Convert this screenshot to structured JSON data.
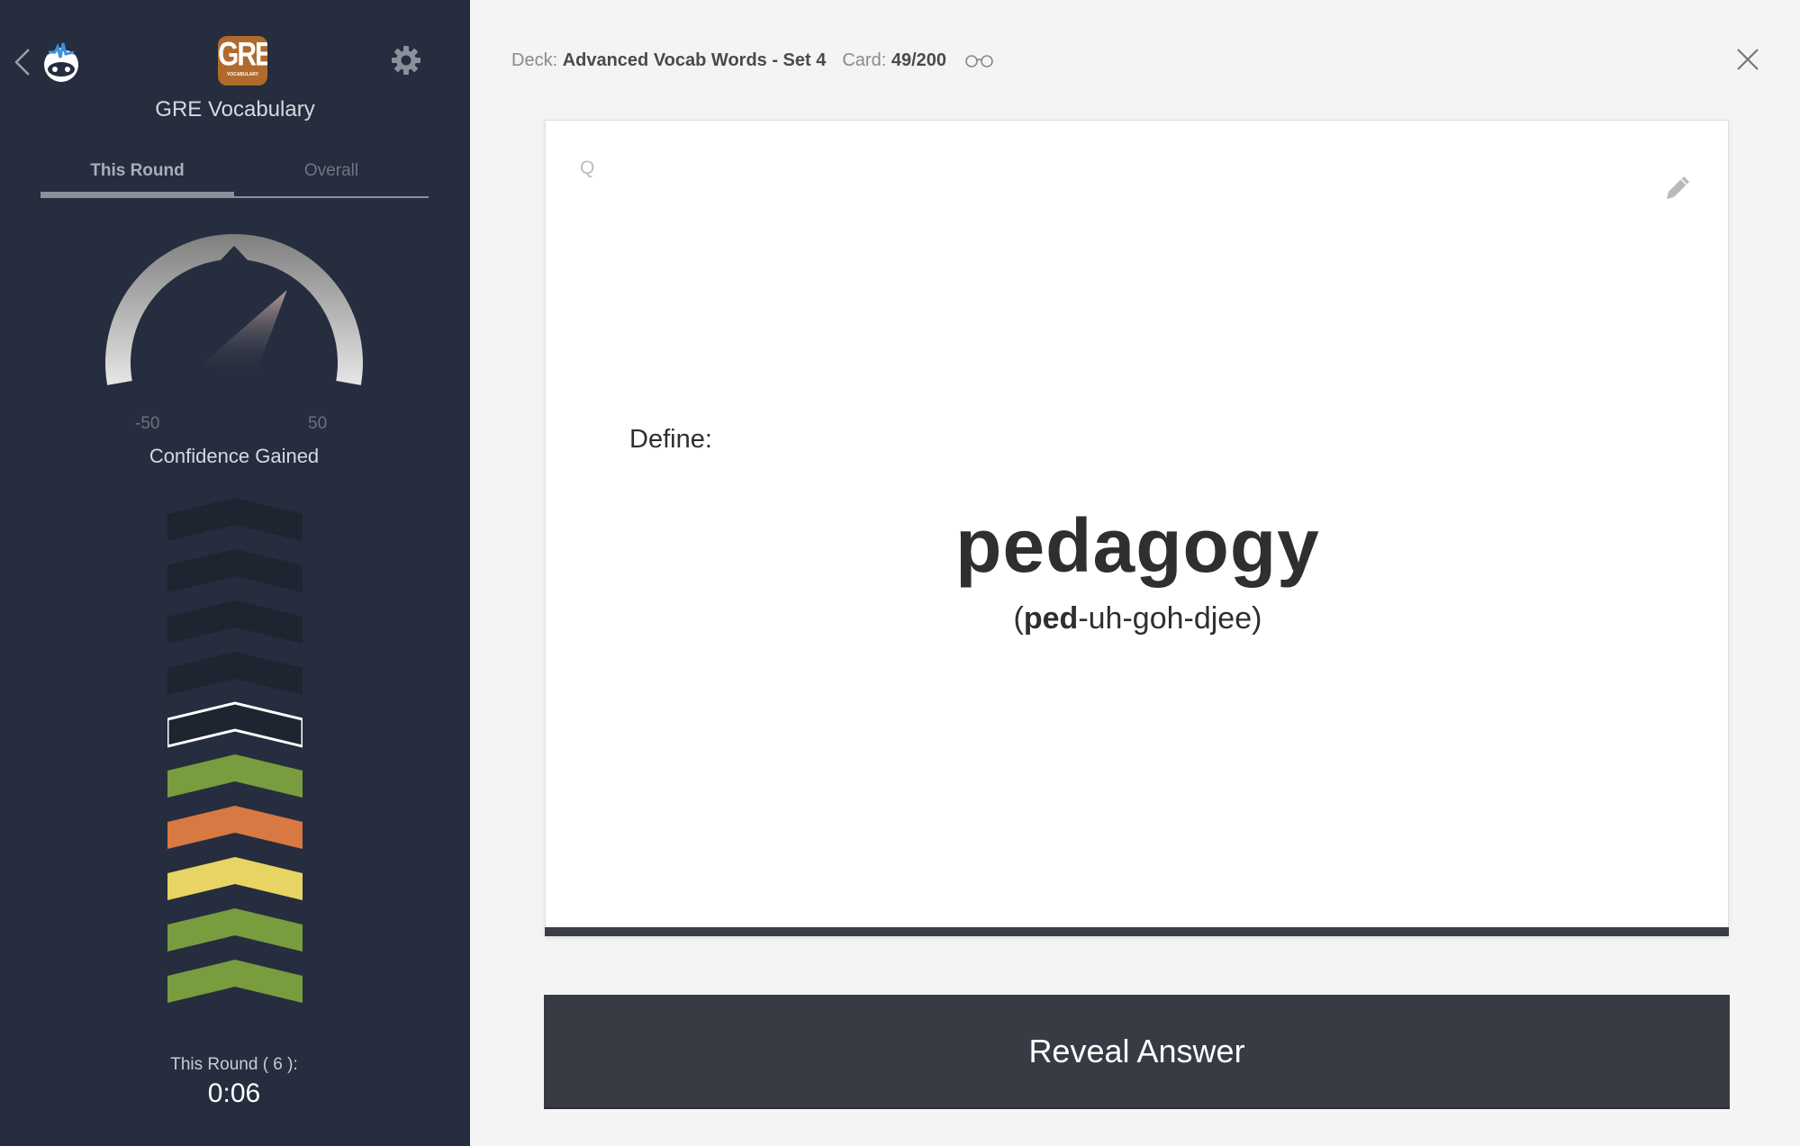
{
  "app": {
    "title": "GRE Vocabulary",
    "logo_text_main": "GRE",
    "logo_text_sub": "VOCABULARY",
    "brand_color": "#b06a2c",
    "back_icon": "chevron-left-icon",
    "brain_logo_icon": "brainscape-logo-icon",
    "settings_icon": "gear-icon"
  },
  "sidebar": {
    "tabs": [
      {
        "label": "This Round",
        "active": true
      },
      {
        "label": "Overall",
        "active": false
      }
    ],
    "gauge": {
      "min_label": "-50",
      "max_label": "50",
      "min": -50,
      "max": 50,
      "value": 20,
      "caption": "Confidence Gained"
    },
    "confidence_meter": {
      "items": [
        {
          "state": "empty",
          "color": "#1f2431"
        },
        {
          "state": "empty",
          "color": "#1f2431"
        },
        {
          "state": "empty",
          "color": "#1f2431"
        },
        {
          "state": "empty",
          "color": "#1f2431"
        },
        {
          "state": "current",
          "color": "#1f2431"
        },
        {
          "state": "rated",
          "color": "#789c3e"
        },
        {
          "state": "rated",
          "color": "#d87842"
        },
        {
          "state": "rated",
          "color": "#e7d462"
        },
        {
          "state": "rated",
          "color": "#789c3e"
        },
        {
          "state": "rated",
          "color": "#789c3e"
        }
      ]
    },
    "round": {
      "label": "This Round ( 6 ):",
      "time": "0:06"
    }
  },
  "header": {
    "deck_label": "Deck:",
    "deck_name": "Advanced Vocab Words - Set 4",
    "card_label": "Card:",
    "card_position": "49/200",
    "preview_icon": "glasses-icon",
    "close_icon": "close-icon"
  },
  "card": {
    "side_label": "Q",
    "edit_icon": "pencil-icon",
    "prompt": "Define:",
    "word": "pedagogy",
    "pronunciation_open": "(",
    "pronunciation_stressed": "ped",
    "pronunciation_rest": "-uh-goh-djee)"
  },
  "actions": {
    "reveal_label": "Reveal Answer"
  }
}
